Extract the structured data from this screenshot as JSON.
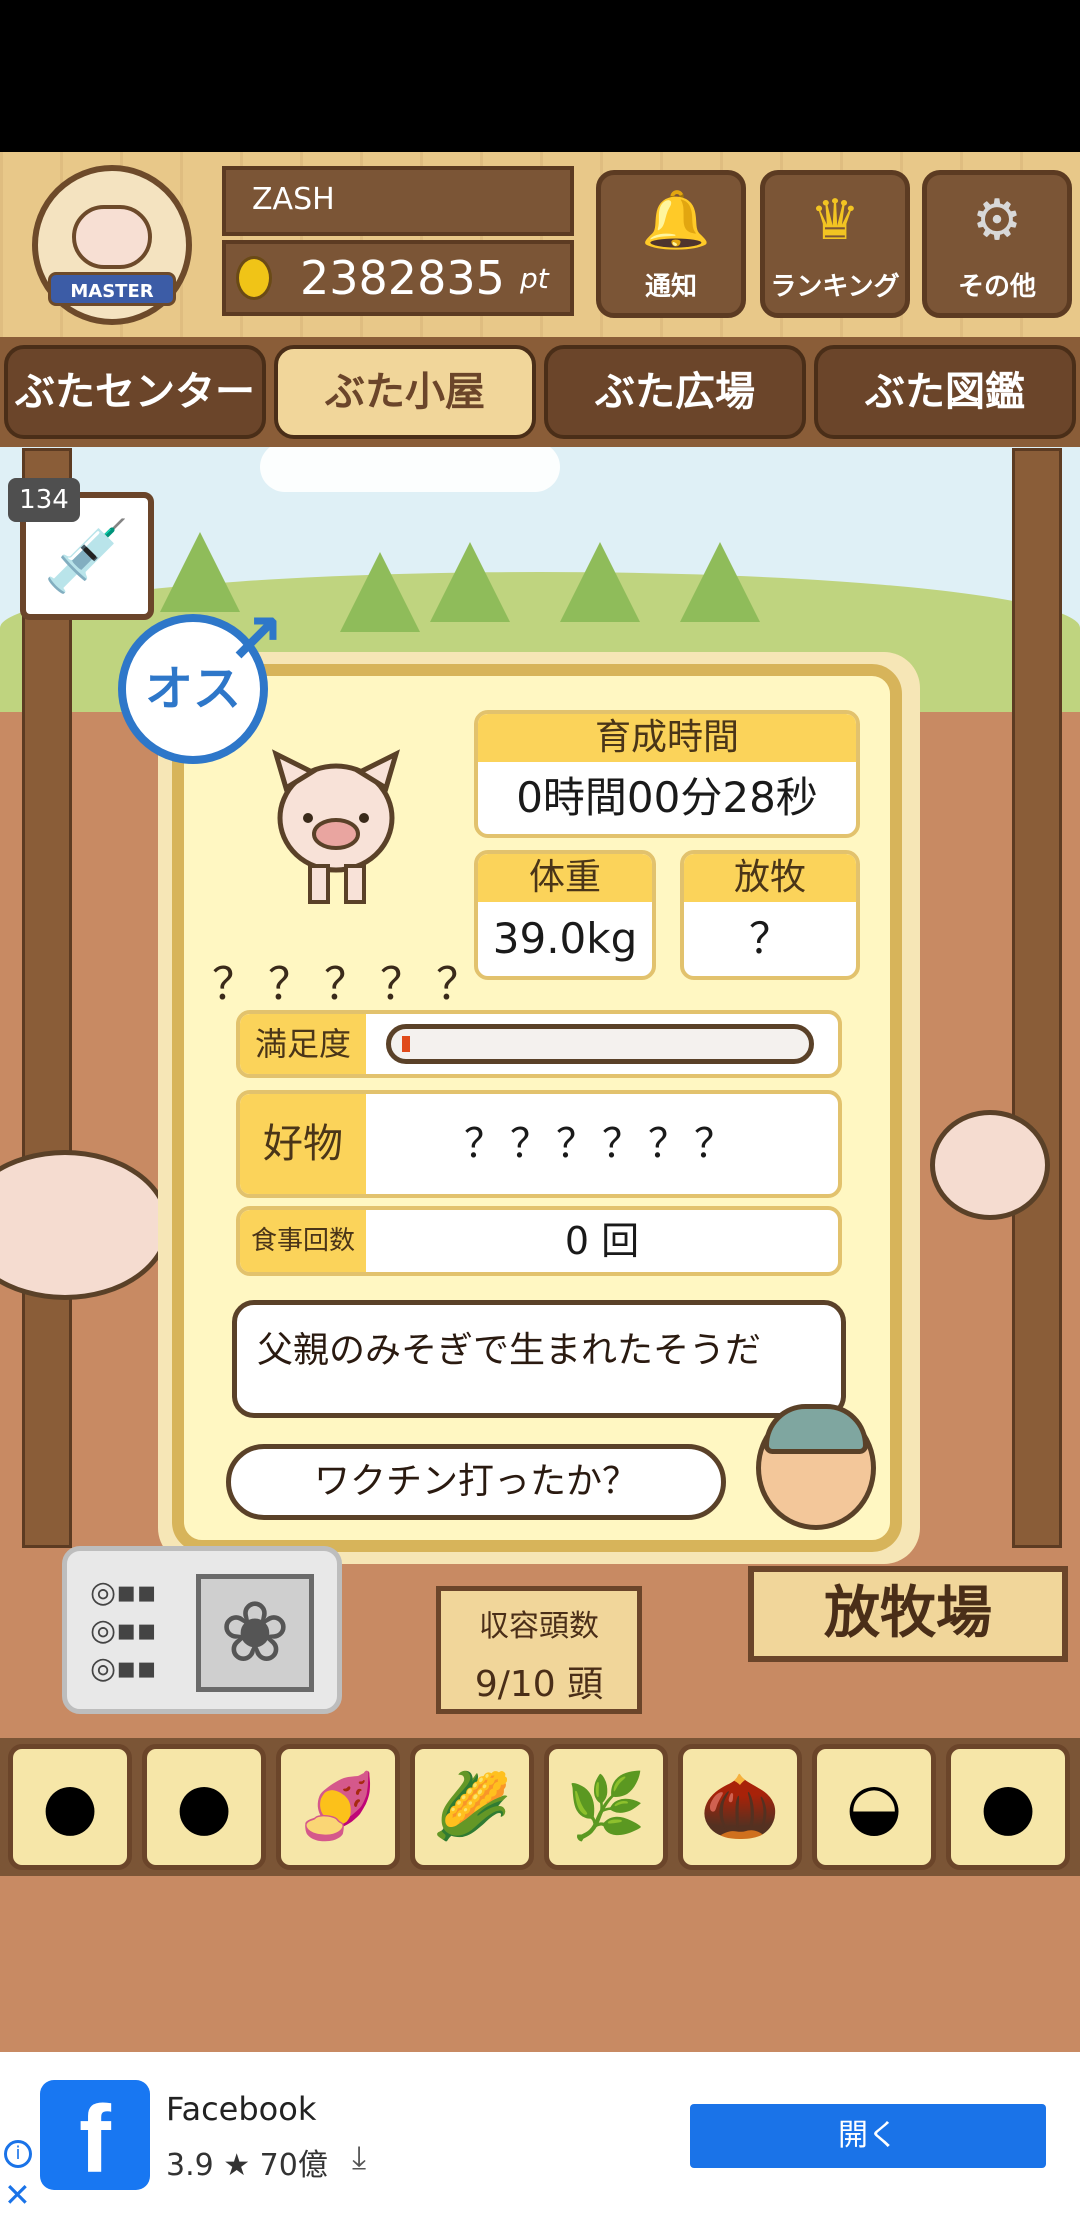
{
  "header": {
    "badge_label": "MASTER",
    "player_name": "ZASH",
    "points_value": "2382835",
    "points_unit": "pt",
    "buttons": [
      {
        "label": "通知",
        "icon": "bell-icon"
      },
      {
        "label": "ランキング",
        "icon": "crown-icon"
      },
      {
        "label": "その他",
        "icon": "gear-icon"
      }
    ]
  },
  "nav": {
    "tabs": [
      {
        "label": "ぶたセンター",
        "active": false
      },
      {
        "label": "ぶた小屋",
        "active": true
      },
      {
        "label": "ぶた広場",
        "active": false
      },
      {
        "label": "ぶた図鑑",
        "active": false
      }
    ]
  },
  "vaccine": {
    "count": "134",
    "icon": "syringe-icon"
  },
  "pig": {
    "gender_label": "オス",
    "name": "？？？？？",
    "raising_time_label": "育成時間",
    "raising_time_value": "0時間00分28秒",
    "weight_label": "体重",
    "weight_value": "39.0kg",
    "grazing_label": "放牧",
    "grazing_value": "？",
    "satisfaction_label": "満足度",
    "satisfaction_level": 0.02,
    "favorite_label": "好物",
    "favorite_value": "？？？？？？",
    "meals_label": "食事回数",
    "meals_value": "0 回",
    "message1": "父親のみそぎで生まれたそうだ",
    "message2": "ワクチン打ったか？"
  },
  "farm": {
    "capacity_label": "収容頭数",
    "capacity_value": "9/10 頭",
    "pasture_label": "放牧場"
  },
  "foods": [
    {
      "icon": "beans-icon"
    },
    {
      "icon": "mixed-beans-icon"
    },
    {
      "icon": "sweet-potato-icon"
    },
    {
      "icon": "corn-icon"
    },
    {
      "icon": "leaves-icon"
    },
    {
      "icon": "acorn-icon"
    },
    {
      "icon": "bowl-beans-icon"
    },
    {
      "icon": "meatballs-icon"
    }
  ],
  "ad": {
    "app_name": "Facebook",
    "rating": "3.9 ★ 70億",
    "open_label": "開く"
  }
}
